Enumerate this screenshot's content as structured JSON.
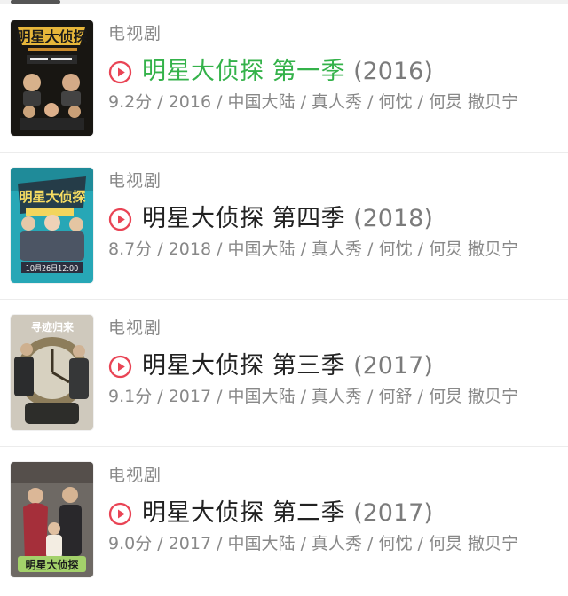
{
  "items": [
    {
      "category": "电视剧",
      "title": "明星大侦探 第一季",
      "year": "(2016)",
      "meta": "9.2分 / 2016 / 中国大陆 / 真人秀 / 何忱 / 何炅 撒贝宁",
      "highlight": true,
      "poster": {
        "icon": "season-1-poster-image",
        "colors": [
          "#1d1a16",
          "#d9a630",
          "#5b4a2f"
        ]
      }
    },
    {
      "category": "电视剧",
      "title": "明星大侦探 第四季",
      "year": "(2018)",
      "meta": "8.7分 / 2018 / 中国大陆 / 真人秀 / 何忱 / 何炅 撒贝宁",
      "highlight": false,
      "poster": {
        "icon": "season-4-poster-image",
        "colors": [
          "#1fa3b1",
          "#f3d35e",
          "#2e394d"
        ]
      }
    },
    {
      "category": "电视剧",
      "title": "明星大侦探 第三季",
      "year": "(2017)",
      "meta": "9.1分 / 2017 / 中国大陆 / 真人秀 / 何舒 / 何炅 撒贝宁",
      "highlight": false,
      "poster": {
        "icon": "season-3-poster-image",
        "colors": [
          "#353631",
          "#a89363",
          "#d8d2c5"
        ]
      }
    },
    {
      "category": "电视剧",
      "title": "明星大侦探 第二季",
      "year": "(2017)",
      "meta": "9.0分 / 2017 / 中国大陆 / 真人秀 / 何忱 / 何炅 撒贝宁",
      "highlight": false,
      "poster": {
        "icon": "season-2-poster-image",
        "colors": [
          "#77706b",
          "#c03e49",
          "#f2e8d7"
        ]
      }
    }
  ],
  "colors": {
    "accent_green": "#34b24a",
    "play_red": "#e94455",
    "secondary_text": "#888888",
    "primary_text": "#222222"
  }
}
